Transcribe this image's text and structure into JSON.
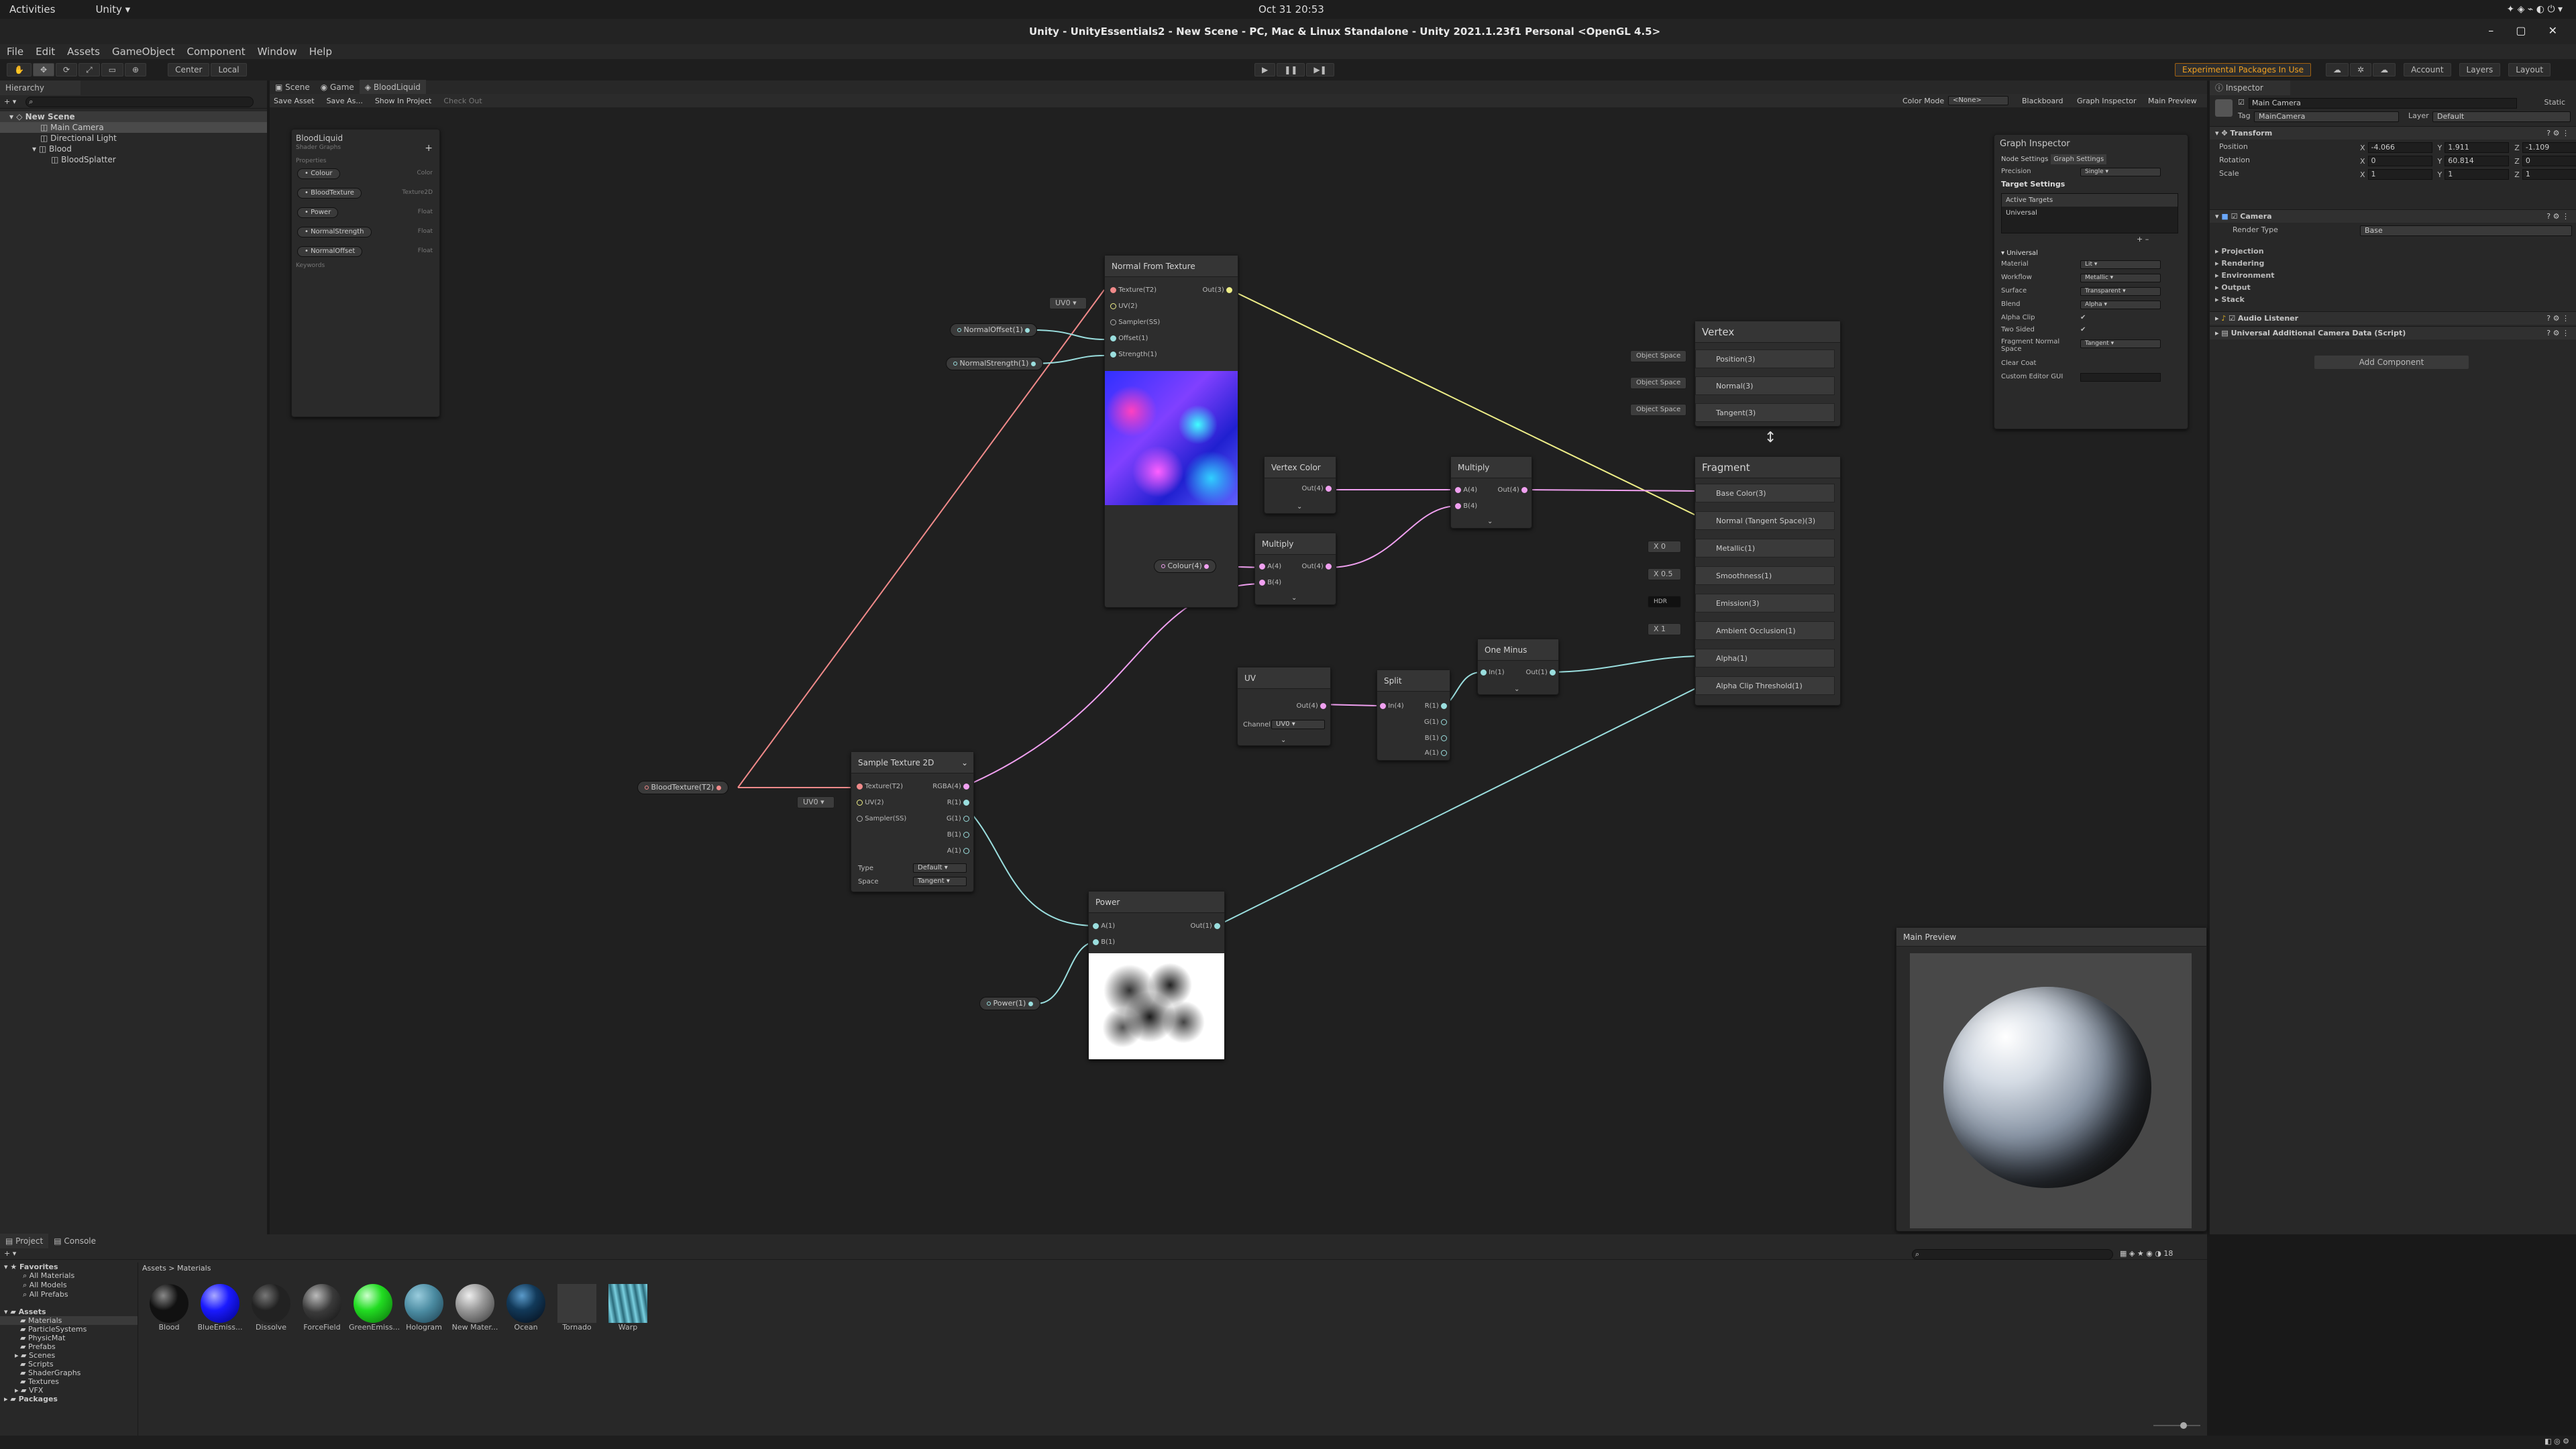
{
  "os": {
    "activities": "Activities",
    "app": "Unity ▾",
    "clock": "Oct 31  20:53"
  },
  "window": {
    "title": "Unity - UnityEssentials2 - New Scene - PC, Mac & Linux Standalone - Unity 2021.1.23f1 Personal <OpenGL 4.5>"
  },
  "menu": [
    "File",
    "Edit",
    "Assets",
    "GameObject",
    "Component",
    "Window",
    "Help"
  ],
  "toolbar": {
    "pivot": "Center",
    "space": "Local",
    "experimental": "Experimental Packages In Use",
    "account": "Account",
    "layers": "Layers",
    "layout": "Layout"
  },
  "hierarchy": {
    "tab": "Hierarchy",
    "items": [
      {
        "label": "New Scene",
        "indent": 0
      },
      {
        "label": "Main Camera",
        "indent": 2
      },
      {
        "label": "Directional Light",
        "indent": 2
      },
      {
        "label": "Blood",
        "indent": 2
      },
      {
        "label": "BloodSplatter",
        "indent": 4
      }
    ]
  },
  "scene_tabs": [
    "Scene",
    "Game",
    "BloodLiquid"
  ],
  "graph_toolbar": {
    "save": "Save Asset",
    "save_as": "Save As...",
    "show": "Show In Project",
    "checkout": "Check Out",
    "color_mode_label": "Color Mode",
    "color_mode": "<None>",
    "blackboard": "Blackboard",
    "graph_inspector": "Graph Inspector",
    "main_preview": "Main Preview"
  },
  "blackboard": {
    "title": "BloodLiquid",
    "subtitle": "Shader Graphs",
    "section": "Properties",
    "keywords": "Keywords",
    "props": [
      {
        "name": "Colour",
        "type": "Color"
      },
      {
        "name": "BloodTexture",
        "type": "Texture2D"
      },
      {
        "name": "Power",
        "type": "Float"
      },
      {
        "name": "NormalStrength",
        "type": "Float"
      },
      {
        "name": "NormalOffset",
        "type": "Float"
      }
    ]
  },
  "nodes": {
    "normal_from_texture": {
      "title": "Normal From Texture",
      "inputs": [
        "Texture(T2)",
        "UV(2)",
        "Sampler(SS)",
        "Offset(1)",
        "Strength(1)"
      ],
      "output": "Out(3)",
      "uv": "UV0"
    },
    "vertex_color": {
      "title": "Vertex Color",
      "output": "Out(4)"
    },
    "multiply1": {
      "title": "Multiply",
      "inputs": [
        "A(4)",
        "B(4)"
      ],
      "output": "Out(4)"
    },
    "multiply2": {
      "title": "Multiply",
      "inputs": [
        "A(4)",
        "B(4)"
      ],
      "output": "Out(4)"
    },
    "uv": {
      "title": "UV",
      "output": "Out(4)",
      "channel_label": "Channel",
      "channel": "UV0"
    },
    "split": {
      "title": "Split",
      "input": "In(4)",
      "outputs": [
        "R(1)",
        "G(1)",
        "B(1)",
        "A(1)"
      ]
    },
    "one_minus": {
      "title": "One Minus",
      "input": "In(1)",
      "output": "Out(1)"
    },
    "sample_texture": {
      "title": "Sample Texture 2D",
      "inputs": [
        "Texture(T2)",
        "UV(2)",
        "Sampler(SS)"
      ],
      "outputs": [
        "RGBA(4)",
        "R(1)",
        "G(1)",
        "B(1)",
        "A(1)"
      ],
      "type_label": "Type",
      "type": "Default",
      "space_label": "Space",
      "space": "Tangent",
      "uv": "UV0"
    },
    "power": {
      "title": "Power",
      "inputs": [
        "A(1)",
        "B(1)"
      ],
      "output": "Out(1)"
    }
  },
  "props_on_graph": {
    "normal_offset": "NormalOffset(1)",
    "normal_strength": "NormalStrength(1)",
    "colour": "Colour(4)",
    "blood_texture": "BloodTexture(T2)",
    "power": "Power(1)"
  },
  "vertex": {
    "title": "Vertex",
    "ports": [
      {
        "label": "Position(3)",
        "space": "Object Space"
      },
      {
        "label": "Normal(3)",
        "space": "Object Space"
      },
      {
        "label": "Tangent(3)",
        "space": "Object Space"
      }
    ]
  },
  "fragment": {
    "title": "Fragment",
    "ports": [
      {
        "label": "Base Color(3)",
        "value": ""
      },
      {
        "label": "Normal (Tangent Space)(3)",
        "value": ""
      },
      {
        "label": "Metallic(1)",
        "value": "0"
      },
      {
        "label": "Smoothness(1)",
        "value": "0.5"
      },
      {
        "label": "Emission(3)",
        "value": "HDR"
      },
      {
        "label": "Ambient Occlusion(1)",
        "value": "1"
      },
      {
        "label": "Alpha(1)",
        "value": ""
      },
      {
        "label": "Alpha Clip Threshold(1)",
        "value": ""
      }
    ]
  },
  "graph_inspector": {
    "title": "Graph Inspector",
    "tabs": [
      "Node Settings",
      "Graph Settings"
    ],
    "precision_label": "Precision",
    "precision": "Single",
    "target_settings": "Target Settings",
    "active_targets": "Active Targets",
    "target": "Universal",
    "universal": "Universal",
    "fields": [
      {
        "label": "Material",
        "value": "Lit"
      },
      {
        "label": "Workflow",
        "value": "Metallic"
      },
      {
        "label": "Surface",
        "value": "Transparent"
      },
      {
        "label": "Blend",
        "value": "Alpha"
      },
      {
        "label": "Alpha Clip",
        "value": "✔"
      },
      {
        "label": "Two Sided",
        "value": "✔"
      },
      {
        "label": "Fragment Normal Space",
        "value": "Tangent"
      },
      {
        "label": "Clear Coat",
        "value": ""
      },
      {
        "label": "Custom Editor GUI",
        "value": ""
      }
    ]
  },
  "main_preview": {
    "title": "Main Preview"
  },
  "inspector": {
    "tab": "Inspector",
    "object": "Main Camera",
    "static": "Static",
    "tag_label": "Tag",
    "tag": "MainCamera",
    "layer_label": "Layer",
    "layer": "Default",
    "transform": {
      "title": "Transform",
      "position": {
        "label": "Position",
        "x": "-4.066",
        "y": "1.911",
        "z": "-1.109"
      },
      "rotation": {
        "label": "Rotation",
        "x": "0",
        "y": "60.814",
        "z": "0"
      },
      "scale": {
        "label": "Scale",
        "x": "1",
        "y": "1",
        "z": "1"
      }
    },
    "camera": {
      "title": "Camera",
      "render_type_label": "Render Type",
      "render_type": "Base",
      "sections": [
        "Projection",
        "Rendering",
        "Environment",
        "Output",
        "Stack"
      ]
    },
    "audio": "Audio Listener",
    "additional": "Universal Additional Camera Data (Script)",
    "add_component": "Add Component"
  },
  "project": {
    "tabs": [
      "Project",
      "Console"
    ],
    "favorites": "Favorites",
    "fav_items": [
      "All Materials",
      "All Models",
      "All Prefabs"
    ],
    "assets": "Assets",
    "folders": [
      "Materials",
      "ParticleSystems",
      "PhysicMat",
      "Prefabs",
      "Scenes",
      "Scripts",
      "ShaderGraphs",
      "Textures",
      "VFX"
    ],
    "packages": "Packages",
    "breadcrumb": "Assets > Materials",
    "materials": [
      {
        "name": "Blood",
        "color": "#111111"
      },
      {
        "name": "BlueEmiss...",
        "color": "#1a1aff"
      },
      {
        "name": "Dissolve",
        "color": "#222222"
      },
      {
        "name": "ForceField",
        "color": "#3a3a3a"
      },
      {
        "name": "GreenEmiss...",
        "color": "#22dd22"
      },
      {
        "name": "Hologram",
        "color": "#4a8aa0"
      },
      {
        "name": "New Mater...",
        "color": "#9a9a9a"
      },
      {
        "name": "Ocean",
        "color": "#123a5a"
      },
      {
        "name": "Tornado",
        "color": "#3a3a3a"
      },
      {
        "name": "Warp",
        "color": "#3a8a9a"
      }
    ]
  }
}
